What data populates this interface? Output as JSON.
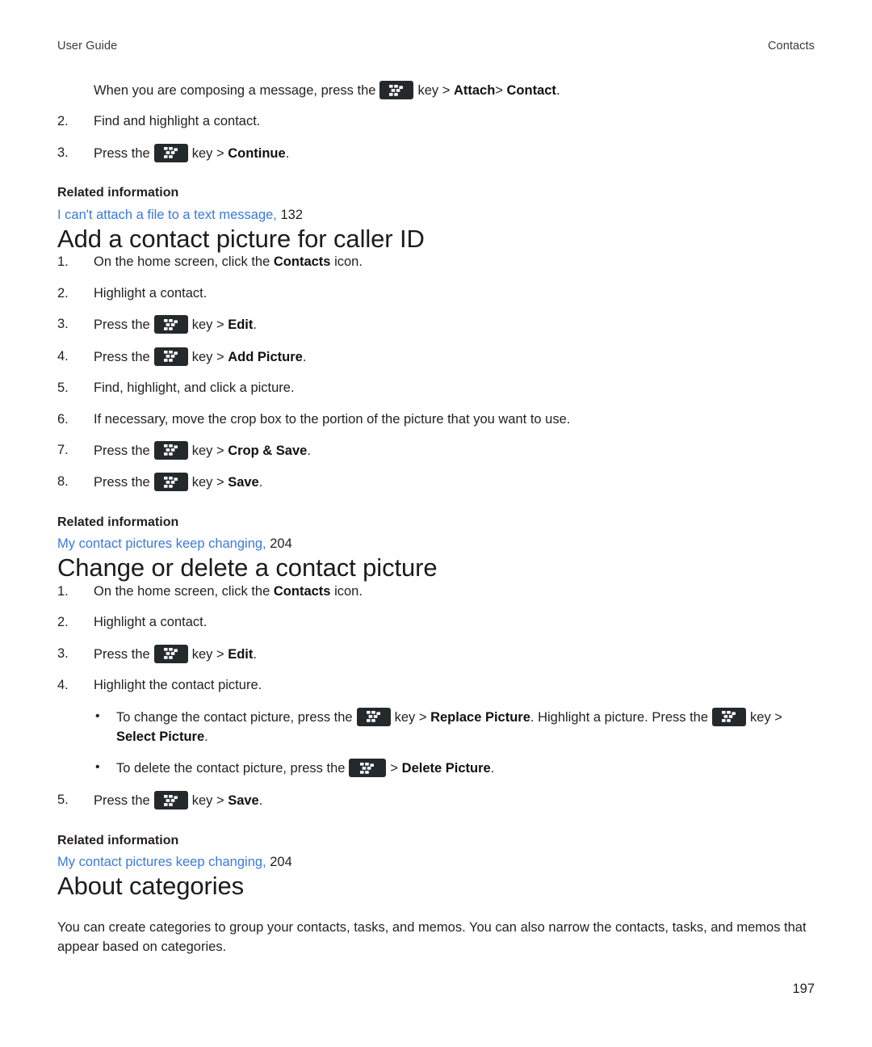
{
  "header": {
    "left": "User Guide",
    "right": "Contacts"
  },
  "icons": {
    "menu_key": "blackberry-menu-key-icon"
  },
  "colors": {
    "link": "#3a7ad9",
    "text": "#231f20",
    "key_icon_bg": "#24292c"
  },
  "intro_block": {
    "continuation_step": {
      "pre": "When you are composing a message, press the",
      "mid": "key >",
      "bold1": "Attach",
      "sep": ">",
      "bold2": "Contact",
      "end": "."
    },
    "steps": [
      {
        "num": "2.",
        "text": "Find and highlight a contact."
      },
      {
        "num": "3.",
        "pre": "Press the",
        "mid": "key >",
        "bold1": "Continue",
        "end": "."
      }
    ],
    "related": {
      "title": "Related information",
      "link": "I can't attach a file to a text message,",
      "page": "132"
    }
  },
  "section_add": {
    "title": "Add a contact picture for caller ID",
    "steps": [
      {
        "num": "1.",
        "pre": "On the home screen, click the",
        "bold1": "Contacts",
        "end": "icon."
      },
      {
        "num": "2.",
        "text": "Highlight a contact."
      },
      {
        "num": "3.",
        "pre": "Press the",
        "mid": "key >",
        "bold1": "Edit",
        "end": "."
      },
      {
        "num": "4.",
        "pre": "Press the",
        "mid": "key >",
        "bold1": "Add Picture",
        "end": "."
      },
      {
        "num": "5.",
        "text": "Find, highlight, and click a picture."
      },
      {
        "num": "6.",
        "text": "If necessary, move the crop box to the portion of the picture that you want to use."
      },
      {
        "num": "7.",
        "pre": "Press the",
        "mid": "key >",
        "bold1": "Crop & Save",
        "end": "."
      },
      {
        "num": "8.",
        "pre": "Press the",
        "mid": "key >",
        "bold1": "Save",
        "end": "."
      }
    ],
    "related": {
      "title": "Related information",
      "link": "My contact pictures keep changing,",
      "page": "204"
    }
  },
  "section_change": {
    "title": "Change or delete a contact picture",
    "steps": [
      {
        "num": "1.",
        "pre": "On the home screen, click the",
        "bold1": "Contacts",
        "end": "icon."
      },
      {
        "num": "2.",
        "text": "Highlight a contact."
      },
      {
        "num": "3.",
        "pre": "Press the",
        "mid": "key >",
        "bold1": "Edit",
        "end": "."
      },
      {
        "num": "4.",
        "text": "Highlight the contact picture."
      }
    ],
    "bullets": [
      {
        "pre": "To change the contact picture, press the",
        "mid1": "key >",
        "bold1": "Replace Picture",
        "mid2": ". Highlight a picture. Press the",
        "mid3": "key",
        "mid4": ">",
        "bold2": "Select Picture",
        "end": "."
      },
      {
        "pre": "To delete the contact picture, press the",
        "mid1": ">",
        "bold1": "Delete Picture",
        "end": "."
      }
    ],
    "final_step": {
      "num": "5.",
      "pre": "Press the",
      "mid": "key >",
      "bold1": "Save",
      "end": "."
    },
    "related": {
      "title": "Related information",
      "link": "My contact pictures keep changing,",
      "page": "204"
    }
  },
  "section_about": {
    "title": "About categories",
    "paragraph": "You can create categories to group your contacts, tasks, and memos. You can also narrow the contacts, tasks, and memos that appear based on categories."
  },
  "footer": {
    "page_number": "197"
  }
}
